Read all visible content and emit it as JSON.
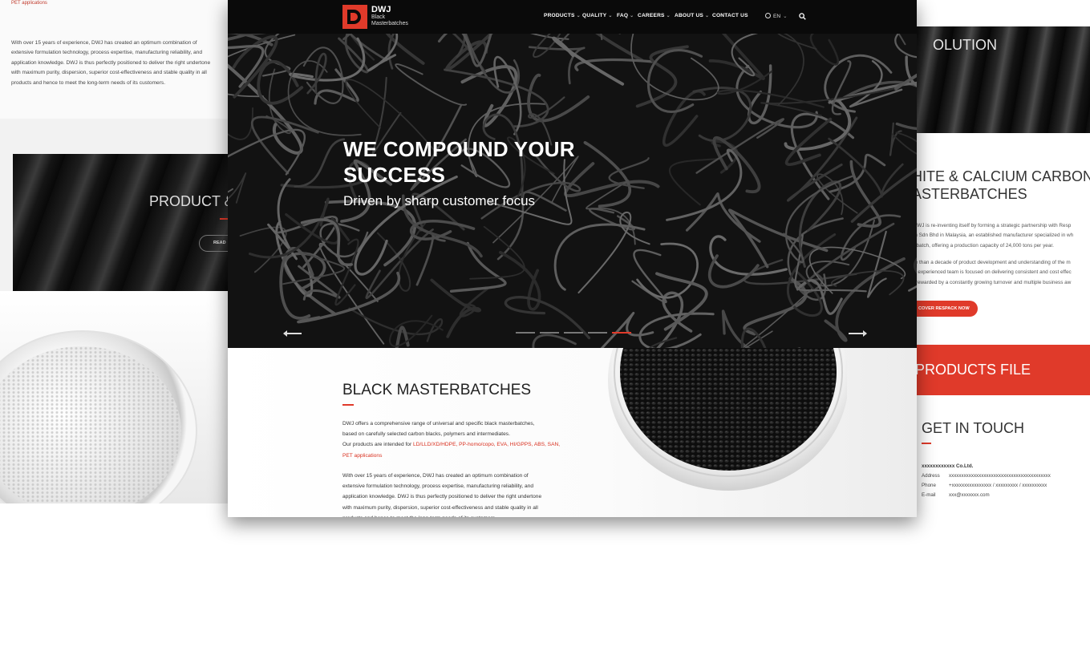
{
  "left_panel": {
    "pre_text": "PET applications",
    "paragraph": "With over 15 years of experience, DWJ has created an optimum combination of\nextensive formulation technology, process expertise, manufacturing reliability, and\napplication knowledge. DWJ is thus perfectly positioned to deliver the right undertone\nwith maximum purity, dispersion, superior cost-effectiveness and stable quality in all\nproducts and hence to meet the long-term needs of its customers.",
    "banner_title": "PRODUCT &",
    "read_button": "READ"
  },
  "nav": {
    "logo_brand": "DWJ",
    "logo_sub1": "Black",
    "logo_sub2": "Masterbatches",
    "items": [
      {
        "label": "PRODUCTS"
      },
      {
        "label": "QUALITY"
      },
      {
        "label": "FAQ"
      },
      {
        "label": "CAREERS"
      },
      {
        "label": "ABOUT US"
      },
      {
        "label": "CONTACT US"
      }
    ],
    "language": "EN",
    "search_icon": "search-icon"
  },
  "hero": {
    "title": "WE COMPOUND YOUR SUCCESS",
    "subtitle": "Driven by sharp customer focus",
    "slide_count": 5,
    "active_slide": 5
  },
  "content": {
    "title": "BLACK MASTERBATCHES",
    "p1_line1": "DWJ offers a comprehensive range of universal and specific black masterbatches,",
    "p1_line2": "based on carefully selected carbon blacks, polymers and intermediates.",
    "p1_line3_prefix": "Our products are intended for ",
    "p1_line3_link": "LD/LLD/XD/HDPE, PP-homo/copo, EVA, HI/GPPS, ABS, SAN,",
    "p1_line4_link": "PET applications",
    "p2": "With over 15 years of experience, DWJ has created an optimum combination of\nextensive formulation technology, process expertise, manufacturing reliability, and\napplication knowledge. DWJ is thus perfectly positioned to deliver the right undertone\nwith maximum purity, dispersion, superior cost-effectiveness and stable quality in all\nproducts and hence to meet the long-term needs of its customers."
  },
  "right_panel": {
    "banner_title": "OLUTION",
    "title": "HITE & CALCIUM CARBON\nASTERBATCHES",
    "p1": ", DWJ is re-inventing itself by forming a strategic partnership with Resp\nem Sdn Bhd in Malaysia, an established manufacturer specialized in wh\nterbatch, offering a production capacity of 24,000 tons per year.",
    "p2": "ore than a decade of product development and understanding of the m\nk's experienced team is focused on delivering consistent and cost effec\ns, rewarded by a constantly growing turnover and multiple business aw",
    "discover_button": "COVER RESPACK NOW",
    "products_file": "PRODUCTS FILE",
    "get_in_touch": "GET IN TOUCH",
    "company": "xxxxxxxxxxxx Co.Ltd.",
    "contacts": [
      {
        "label": "Address",
        "value": "xxxxxxxxxxxxxxxxxxxxxxxxxxxxxxxxxxxxxxxxx"
      },
      {
        "label": "Phone",
        "value": "+xxxxxxxxxxxxxxxx  /  xxxxxxxxx  /  xxxxxxxxxx"
      },
      {
        "label": "E-mail",
        "value": "xxx@xxxxxxx.com"
      }
    ]
  },
  "colors": {
    "accent_red": "#e03a2a",
    "nav_bg": "#0a0a0a",
    "hero_bg": "#121212"
  }
}
